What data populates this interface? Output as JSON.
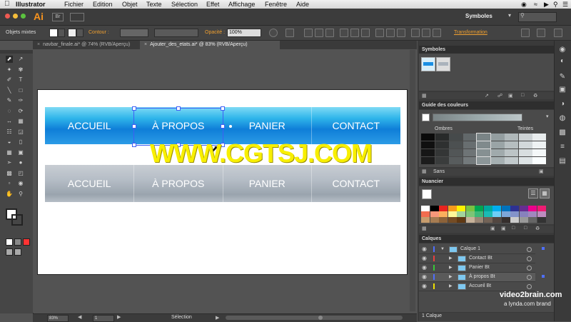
{
  "os_menu": {
    "apple": "",
    "app_name": "Illustrator",
    "items": [
      "Fichier",
      "Edition",
      "Objet",
      "Texte",
      "Sélection",
      "Effet",
      "Affichage",
      "Fenêtre",
      "Aide"
    ]
  },
  "appbar": {
    "logo": "Ai",
    "bridge": "Br",
    "workspace": "Symboles"
  },
  "control": {
    "selection_type": "Objets mixtes",
    "stroke_label": "Contour :",
    "opacity_label": "Opacité :",
    "opacity_value": "100%",
    "transform_label": "Transformation"
  },
  "tabs": [
    {
      "label": "navbar_finale.ai* @ 74% (RVB/Aperçu)"
    },
    {
      "label": "Ajouter_des_etats.ai* @ 83% (RVB/Aperçu)"
    }
  ],
  "artwork": {
    "nav_active": [
      "ACCUEIL",
      "À PROPOS",
      "PANIER",
      "CONTACT"
    ],
    "nav_inactive": [
      "ACCUEIL",
      "À PROPOS",
      "PANIER",
      "CONTACT"
    ]
  },
  "watermark": "WWW.CGTSJ.COM",
  "status": {
    "zoom": "83%",
    "page": "1",
    "tool": "Sélection"
  },
  "panels": {
    "symbols_title": "Symboles",
    "color_guide_title": "Guide des couleurs",
    "shades_label": "Ombres",
    "tints_label": "Teintes",
    "color_guide_footer": "Sans",
    "swatches_title": "Nuancier",
    "layers_title": "Calques",
    "layers_footer": "1 Calque",
    "layers": [
      {
        "name": "Calque 1",
        "color": "#4f6fff",
        "level": 0
      },
      {
        "name": "Contact Bt",
        "color": "#e84040",
        "level": 1
      },
      {
        "name": "Panier Bt",
        "color": "#38c838",
        "level": 1
      },
      {
        "name": "À propos Bt",
        "color": "#4f6fff",
        "level": 1,
        "selected": true
      },
      {
        "name": "Accueil Bt",
        "color": "#f0e000",
        "level": 1
      }
    ]
  },
  "branding": {
    "main": "video2brain.com",
    "sub": "a lynda.com brand"
  },
  "colors": {
    "nav_active_blue": "#1a8fe3",
    "nav_inactive_gray": "#aab3bc",
    "selection_blue": "#3f5ef5",
    "watermark_yellow": "#f8ef00"
  }
}
